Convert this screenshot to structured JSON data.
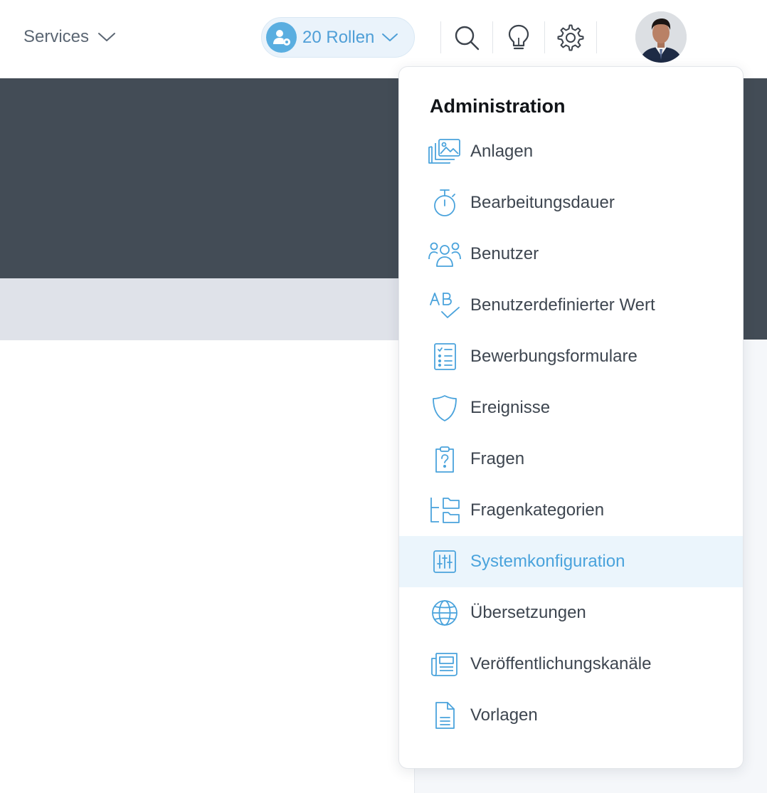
{
  "header": {
    "services_label": "Services",
    "roles_label": "20 Rollen"
  },
  "menu": {
    "title": "Administration",
    "items": [
      {
        "label": "Anlagen",
        "icon": "images-icon"
      },
      {
        "label": "Bearbeitungsdauer",
        "icon": "stopwatch-icon"
      },
      {
        "label": "Benutzer",
        "icon": "users-icon"
      },
      {
        "label": "Benutzerdefinierter Wert",
        "icon": "ab-check-icon"
      },
      {
        "label": "Bewerbungsformulare",
        "icon": "checklist-icon"
      },
      {
        "label": "Ereignisse",
        "icon": "shield-icon"
      },
      {
        "label": "Fragen",
        "icon": "clipboard-question-icon"
      },
      {
        "label": "Fragenkategorien",
        "icon": "folder-tree-icon"
      },
      {
        "label": "Systemkonfiguration",
        "icon": "sliders-icon",
        "active": true
      },
      {
        "label": "Übersetzungen",
        "icon": "globe-icon"
      },
      {
        "label": "Veröffentlichungskanäle",
        "icon": "newspaper-icon"
      },
      {
        "label": "Vorlagen",
        "icon": "document-icon"
      }
    ]
  },
  "colors": {
    "accent": "#4aa3dc",
    "hero": "#434c56",
    "active_bg": "#ebf5fc",
    "text": "#3e4650"
  }
}
